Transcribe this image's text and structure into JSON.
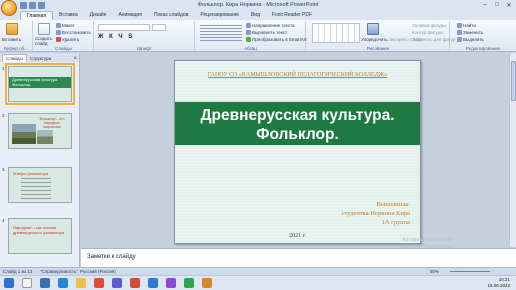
{
  "window": {
    "title": "Фольклор. Кира Норкина - Microsoft PowerPoint",
    "minimize": "–",
    "maximize": "□",
    "close": "✕"
  },
  "tabs": [
    "Главная",
    "Вставка",
    "Дизайн",
    "Анимация",
    "Показ слайдов",
    "Рецензирование",
    "Вид",
    "Foxit Reader PDF"
  ],
  "ribbon": {
    "clipboard": {
      "label": "Буфер об...",
      "paste": "Вставить",
      "cut": "Вырезать",
      "copy": "Копировать"
    },
    "slides": {
      "label": "Слайды",
      "create": "Создать слайд",
      "layout": "Макет",
      "reset": "Восстановить",
      "delete": "Удалить"
    },
    "font": {
      "label": "Шрифт"
    },
    "paragraph": {
      "label": "Абзац",
      "direction": "Направление текста",
      "align": "Выровнять текст",
      "smartart": "Преобразовать в SmartArt"
    },
    "drawing": {
      "label": "Рисование",
      "arrange": "Упорядочить",
      "styles": "Экспресс-стили",
      "fill": "Заливка фигуры",
      "outline": "Контур фигуры",
      "effects": "Эффекты для фигур"
    },
    "editing": {
      "label": "Редактирование",
      "find": "Найти",
      "replace": "Заменить",
      "select": "Выделить"
    }
  },
  "left_panel": {
    "tab_slides": "Слайды",
    "tab_outline": "Структура",
    "close": "×",
    "thumbs": [
      {
        "num": "1",
        "text": "Древнерусская культура. Фольклор."
      },
      {
        "num": "2",
        "text": "Фольклор – это народное творчество"
      },
      {
        "num": "3",
        "text": "Жанры фольклора"
      },
      {
        "num": "4",
        "text": "Народное – как основа древнерусского фольклора"
      }
    ]
  },
  "slide": {
    "college": "ГАПОУ СО «КАМЫШЛОВСКИЙ ПЕДАГОГИЧЕСКИЙ КОЛЛЕДЖ»",
    "title_line1": "Древнерусская культура.",
    "title_line2": "Фольклор.",
    "author_line1": "Выполнила:",
    "author_line2": "студентка Норкина Кира",
    "author_line3": "1А группа",
    "year": "2021 г."
  },
  "notes": {
    "placeholder": "Заметки к слайду"
  },
  "activation": {
    "line1": "Активация Windows",
    "line2": "раздел \"Параметры\"."
  },
  "status": {
    "slide": "Слайд 1 из 13",
    "theme": "\"Справедливость\"",
    "lang": "Русский (Россия)",
    "zoom": "50%"
  },
  "taskbar": {
    "time": "10:21",
    "date": "15.06.2022"
  }
}
